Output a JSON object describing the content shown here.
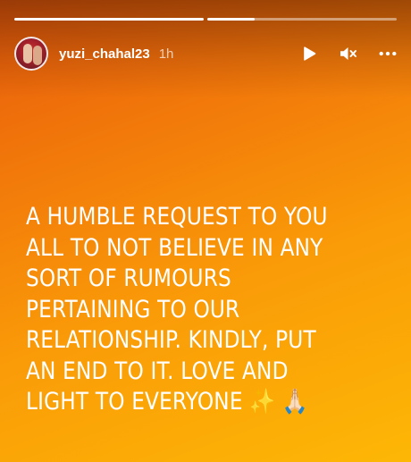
{
  "story": {
    "progress": [
      1.0,
      0.25
    ],
    "user": {
      "username": "yuzi_chahal23",
      "time": "1h"
    },
    "controls": {
      "play_icon": "play-icon",
      "mute_icon": "muted-speaker-icon",
      "more_icon": "more-options-icon"
    },
    "message": "A HUMBLE REQUEST TO YOU\nALL TO NOT BELIEVE IN ANY\nSORT OF RUMOURS\nPERTAINING TO OUR\nRELATIONSHIP. KINDLY, PUT\nAN END TO IT. LOVE AND\nLIGHT TO EVERYONE ✨ 🙏🏻"
  },
  "colors": {
    "gradient_start": "#e85a0c",
    "gradient_end": "#fdb705",
    "text": "#ffffff"
  }
}
